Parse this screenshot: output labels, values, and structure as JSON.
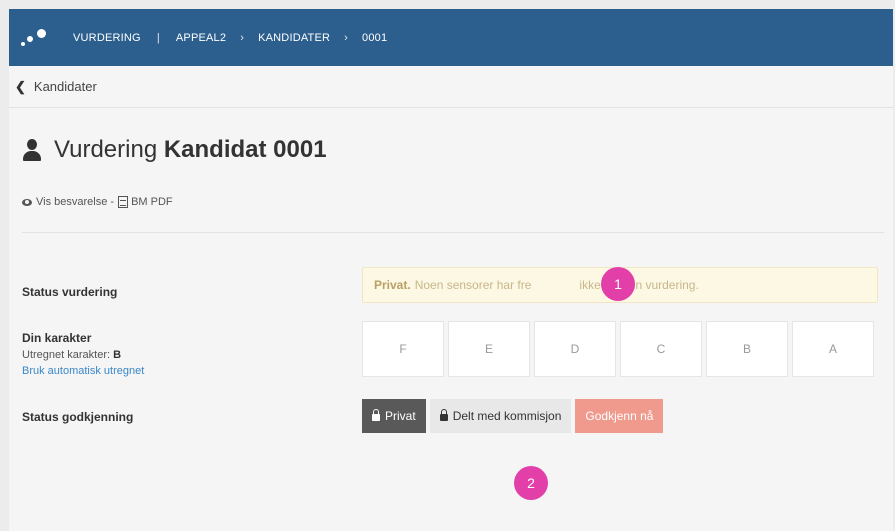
{
  "navbar": {
    "crumbs": [
      "VURDERING",
      "APPEAL2",
      "KANDIDATER",
      "0001"
    ],
    "sep_bar": "|",
    "sep_arrow": "›"
  },
  "back": {
    "label": "Kandidater"
  },
  "header": {
    "title_prefix": "Vurdering",
    "title_bold": "Kandidat 0001"
  },
  "links": {
    "view": "Vis besvarelse",
    "dash": "-",
    "pdf": "BM PDF"
  },
  "status": {
    "label": "Status vurdering",
    "bold": "Privat.",
    "text_before": "Noen sensorer har fre",
    "text_after": "ikke delt sin vurdering."
  },
  "grade": {
    "label": "Din karakter",
    "computed_label": "Utregnet karakter:",
    "computed_value": "B",
    "auto_link": "Bruk automatisk utregnet",
    "options": [
      "F",
      "E",
      "D",
      "C",
      "B",
      "A"
    ]
  },
  "approval": {
    "label": "Status godkjenning",
    "private": "Privat",
    "shared": "Delt med kommisjon",
    "approve": "Godkjenn nå"
  },
  "markers": [
    "1",
    "2"
  ],
  "colors": {
    "navbar": "#2c5f8e",
    "marker": "#e23fa9",
    "approve": "#f09a8d",
    "status_bg": "#fcf8e3",
    "link": "#3a87c8"
  }
}
